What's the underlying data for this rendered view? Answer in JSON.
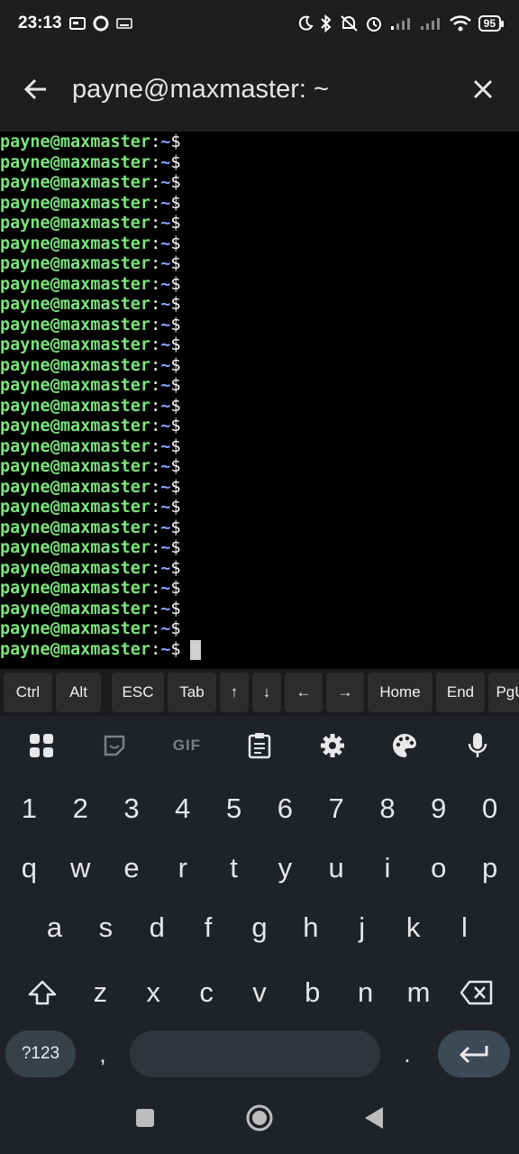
{
  "status": {
    "time": "23:13",
    "battery": "95"
  },
  "appbar": {
    "title": "payne@maxmaster: ~"
  },
  "terminal": {
    "prompt_user": "payne@maxmaster",
    "prompt_colon": ":",
    "prompt_path": "~",
    "prompt_dollar": "$",
    "line_count": 26
  },
  "extra_keys": [
    "Ctrl",
    "Alt",
    "ESC",
    "Tab",
    "↑",
    "↓",
    "←",
    "→",
    "Home",
    "End",
    "PgU"
  ],
  "keyboard": {
    "toolbar_gif": "GIF",
    "row_numbers": [
      "1",
      "2",
      "3",
      "4",
      "5",
      "6",
      "7",
      "8",
      "9",
      "0"
    ],
    "row_top": [
      "q",
      "w",
      "e",
      "r",
      "t",
      "y",
      "u",
      "i",
      "o",
      "p"
    ],
    "row_middle": [
      "a",
      "s",
      "d",
      "f",
      "g",
      "h",
      "j",
      "k",
      "l"
    ],
    "row_bottom": [
      "z",
      "x",
      "c",
      "v",
      "b",
      "n",
      "m"
    ],
    "symbols_key": "?123",
    "comma": ",",
    "period": "."
  },
  "colors": {
    "prompt_user": "#7ce37c",
    "prompt_path": "#8aa3ff",
    "bar_bg": "#1e1e1e",
    "keyboard_bg": "#1f2327"
  }
}
